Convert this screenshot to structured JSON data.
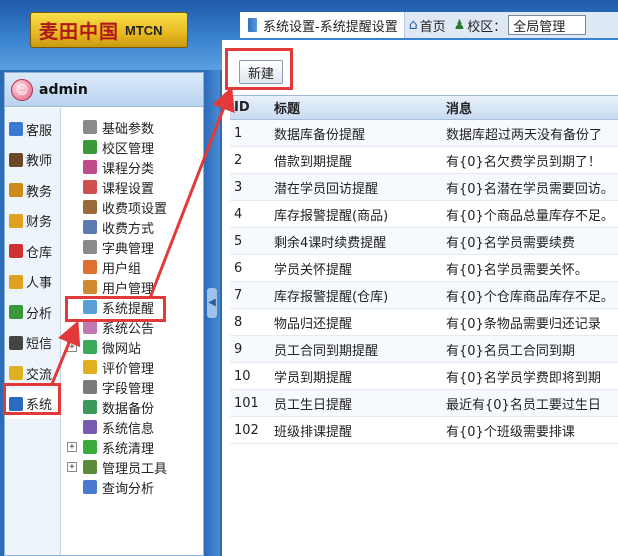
{
  "brand": {
    "logo_cn": "麦田中国",
    "logo_en": "MTCN"
  },
  "tabstrip": {
    "active_tab": "系统设置-系统提醒设置",
    "home_label": "首页",
    "campus_label": "校区：",
    "campus_value": "全局管理"
  },
  "user": {
    "name": "admin"
  },
  "nav": {
    "items": [
      {
        "label": "客服",
        "color": "#3a7ad0"
      },
      {
        "label": "教师",
        "color": "#6a4a2a"
      },
      {
        "label": "教务",
        "color": "#d08a1a"
      },
      {
        "label": "财务",
        "color": "#e0a020"
      },
      {
        "label": "仓库",
        "color": "#d03030"
      },
      {
        "label": "人事",
        "color": "#e0a020"
      },
      {
        "label": "分析",
        "color": "#3a9a3a"
      },
      {
        "label": "短信",
        "color": "#444444"
      },
      {
        "label": "交流",
        "color": "#e0b020"
      },
      {
        "label": "系统",
        "color": "#2a6ac0"
      }
    ]
  },
  "tree": {
    "items": [
      {
        "label": "基础参数",
        "color": "#8a8a8a",
        "expand": ""
      },
      {
        "label": "校区管理",
        "color": "#3a9a3a",
        "expand": ""
      },
      {
        "label": "课程分类",
        "color": "#c04a8a",
        "expand": ""
      },
      {
        "label": "课程设置",
        "color": "#d05050",
        "expand": ""
      },
      {
        "label": "收费项设置",
        "color": "#9a6a3a",
        "expand": ""
      },
      {
        "label": "收费方式",
        "color": "#5a7ab0",
        "expand": ""
      },
      {
        "label": "字典管理",
        "color": "#8a8a8a",
        "expand": ""
      },
      {
        "label": "用户组",
        "color": "#e07030",
        "expand": ""
      },
      {
        "label": "用户管理",
        "color": "#d08a30",
        "expand": ""
      },
      {
        "label": "系统提醒",
        "color": "#5aa0d8",
        "expand": ""
      },
      {
        "label": "系统公告",
        "color": "#c07ab0",
        "expand": ""
      },
      {
        "label": "微网站",
        "color": "#3aaa5a",
        "expand": "+"
      },
      {
        "label": "评价管理",
        "color": "#e0b020",
        "expand": ""
      },
      {
        "label": "字段管理",
        "color": "#7a7a7a",
        "expand": ""
      },
      {
        "label": "数据备份",
        "color": "#3a9a5a",
        "expand": ""
      },
      {
        "label": "系统信息",
        "color": "#7a5ab0",
        "expand": ""
      },
      {
        "label": "系统清理",
        "color": "#3aaa3a",
        "expand": "+"
      },
      {
        "label": "管理员工具",
        "color": "#5a8a3a",
        "expand": "+"
      },
      {
        "label": "查询分析",
        "color": "#4a7ad0",
        "expand": ""
      }
    ]
  },
  "toolbar": {
    "new_label": "新建"
  },
  "grid": {
    "columns": [
      "ID",
      "标题",
      "消息"
    ],
    "rows": [
      [
        "1",
        "数据库备份提醒",
        "数据库超过两天没有备份了"
      ],
      [
        "2",
        "借款到期提醒",
        "有{0}名欠费学员到期了！"
      ],
      [
        "3",
        "潜在学员回访提醒",
        "有{0}名潜在学员需要回访。"
      ],
      [
        "4",
        "库存报警提醒(商品)",
        "有{0}个商品总量库存不足。"
      ],
      [
        "5",
        "剩余4课时续费提醒",
        "有{0}名学员需要续费"
      ],
      [
        "6",
        "学员关怀提醒",
        "有{0}名学员需要关怀。"
      ],
      [
        "7",
        "库存报警提醒(仓库)",
        "有{0}个仓库商品库存不足。"
      ],
      [
        "8",
        "物品归还提醒",
        "有{0}条物品需要归还记录"
      ],
      [
        "9",
        "员工合同到期提醒",
        "有{0}名员工合同到期"
      ],
      [
        "10",
        "学员到期提醒",
        "有{0}名学员学费即将到期"
      ],
      [
        "101",
        "员工生日提醒",
        "最近有{0}名员工要过生日"
      ],
      [
        "102",
        "班级排课提醒",
        "有{0}个班级需要排课"
      ]
    ]
  },
  "annotation_color": "#e23a3a"
}
